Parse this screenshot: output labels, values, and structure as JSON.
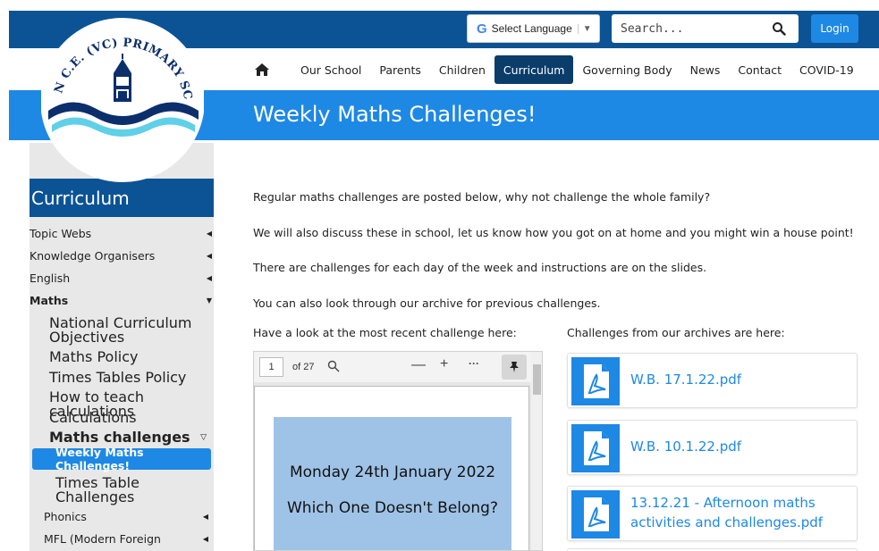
{
  "header": {
    "language_button": "Select Language",
    "language_arrow": "▼",
    "google_letter": "G",
    "search_placeholder": "Search...",
    "login": "Login"
  },
  "logo": {
    "text": "SUTTON C.E. (VC) PRIMARY SCHOOL"
  },
  "nav": {
    "items": [
      "Our School",
      "Parents",
      "Children",
      "Curriculum",
      "Governing Body",
      "News",
      "Contact",
      "COVID-19"
    ],
    "active": "Curriculum"
  },
  "page": {
    "title": "Weekly Maths Challenges!"
  },
  "sidebar": {
    "heading": "Curriculum",
    "items": [
      {
        "label": "Topic Webs",
        "arrow": "◀"
      },
      {
        "label": "Knowledge Organisers",
        "arrow": "◀"
      },
      {
        "label": "English",
        "arrow": "◀"
      },
      {
        "label": "Maths",
        "arrow": "▼"
      }
    ],
    "maths_sub": [
      "National Curriculum Objectives",
      "Maths Policy",
      "Times Tables Policy",
      "How to teach calculations",
      "Calculations",
      "Maths challenges"
    ],
    "maths_challenges_arrow": "▽",
    "active_item": "Weekly Maths Challenges!",
    "times_table": "Times Table Challenges",
    "lower_items": [
      {
        "label": "Phonics",
        "arrow": "◀"
      },
      {
        "label": "MFL (Modern Foreign",
        "arrow": "◀"
      }
    ]
  },
  "main": {
    "paragraphs": [
      "Regular maths challenges are posted below, why not challenge the whole family?",
      "We will also discuss these in school, let us know how you got on at home and you might win a house point!",
      "There are challenges for each day of the week and instructions are on the slides.",
      "You can also look through our archive for previous challenges."
    ],
    "recent_heading": "Have a look at the most recent challenge here:",
    "archive_heading": "Challenges from our archives are here:"
  },
  "pdf": {
    "page": "1",
    "of": "of 27",
    "minus": "—",
    "plus": "+",
    "more": "···",
    "slide_line1": "Monday 24th January 2022",
    "slide_line2": "Which One Doesn't Belong?"
  },
  "archive": [
    {
      "label": "W.B. 17.1.22.pdf"
    },
    {
      "label": "W.B. 10.1.22.pdf"
    },
    {
      "label": "13.12.21 - Afternoon maths activities and challenges.pdf"
    }
  ],
  "colors": {
    "dark_blue": "#0b5394",
    "bright_blue": "#1e88e5",
    "nav_active": "#0b3d6b"
  }
}
